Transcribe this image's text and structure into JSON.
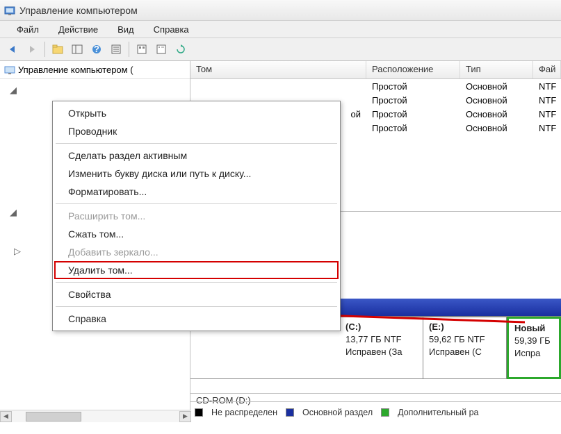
{
  "title": "Управление компьютером",
  "menubar": [
    "Файл",
    "Действие",
    "Вид",
    "Справка"
  ],
  "tree_root": "Управление компьютером (",
  "columns": [
    "Том",
    "Расположение",
    "Тип",
    "Фай"
  ],
  "rows": [
    {
      "vol": "",
      "layout": "Простой",
      "type": "Основной",
      "fs": "NTF"
    },
    {
      "vol": "",
      "layout": "Простой",
      "type": "Основной",
      "fs": "NTF"
    },
    {
      "vol": "ой",
      "layout": "Простой",
      "type": "Основной",
      "fs": "NTF"
    },
    {
      "vol": "",
      "layout": "Простой",
      "type": "Основной",
      "fs": "NTF"
    }
  ],
  "volumes": [
    {
      "title": "(C:)",
      "size": "13,77 ГБ NTF",
      "status": "Исправен (За"
    },
    {
      "title": "(E:)",
      "size": "59,62 ГБ NTF",
      "status": "Исправен (С"
    },
    {
      "title": "Новый",
      "size": "59,39 ГБ",
      "status": "Испра"
    }
  ],
  "cdrom": "CD-ROM (D:)",
  "legend": {
    "unalloc": "Не распределен",
    "primary": "Основной раздел",
    "ext": "Дополнительный ра"
  },
  "context_menu": {
    "open": "Открыть",
    "explorer": "Проводник",
    "make_active": "Сделать раздел активным",
    "change_letter": "Изменить букву диска или путь к диску...",
    "format": "Форматировать...",
    "extend": "Расширить том...",
    "shrink": "Сжать том...",
    "mirror": "Добавить зеркало...",
    "delete": "Удалить том...",
    "properties": "Свойства",
    "help": "Справка"
  }
}
